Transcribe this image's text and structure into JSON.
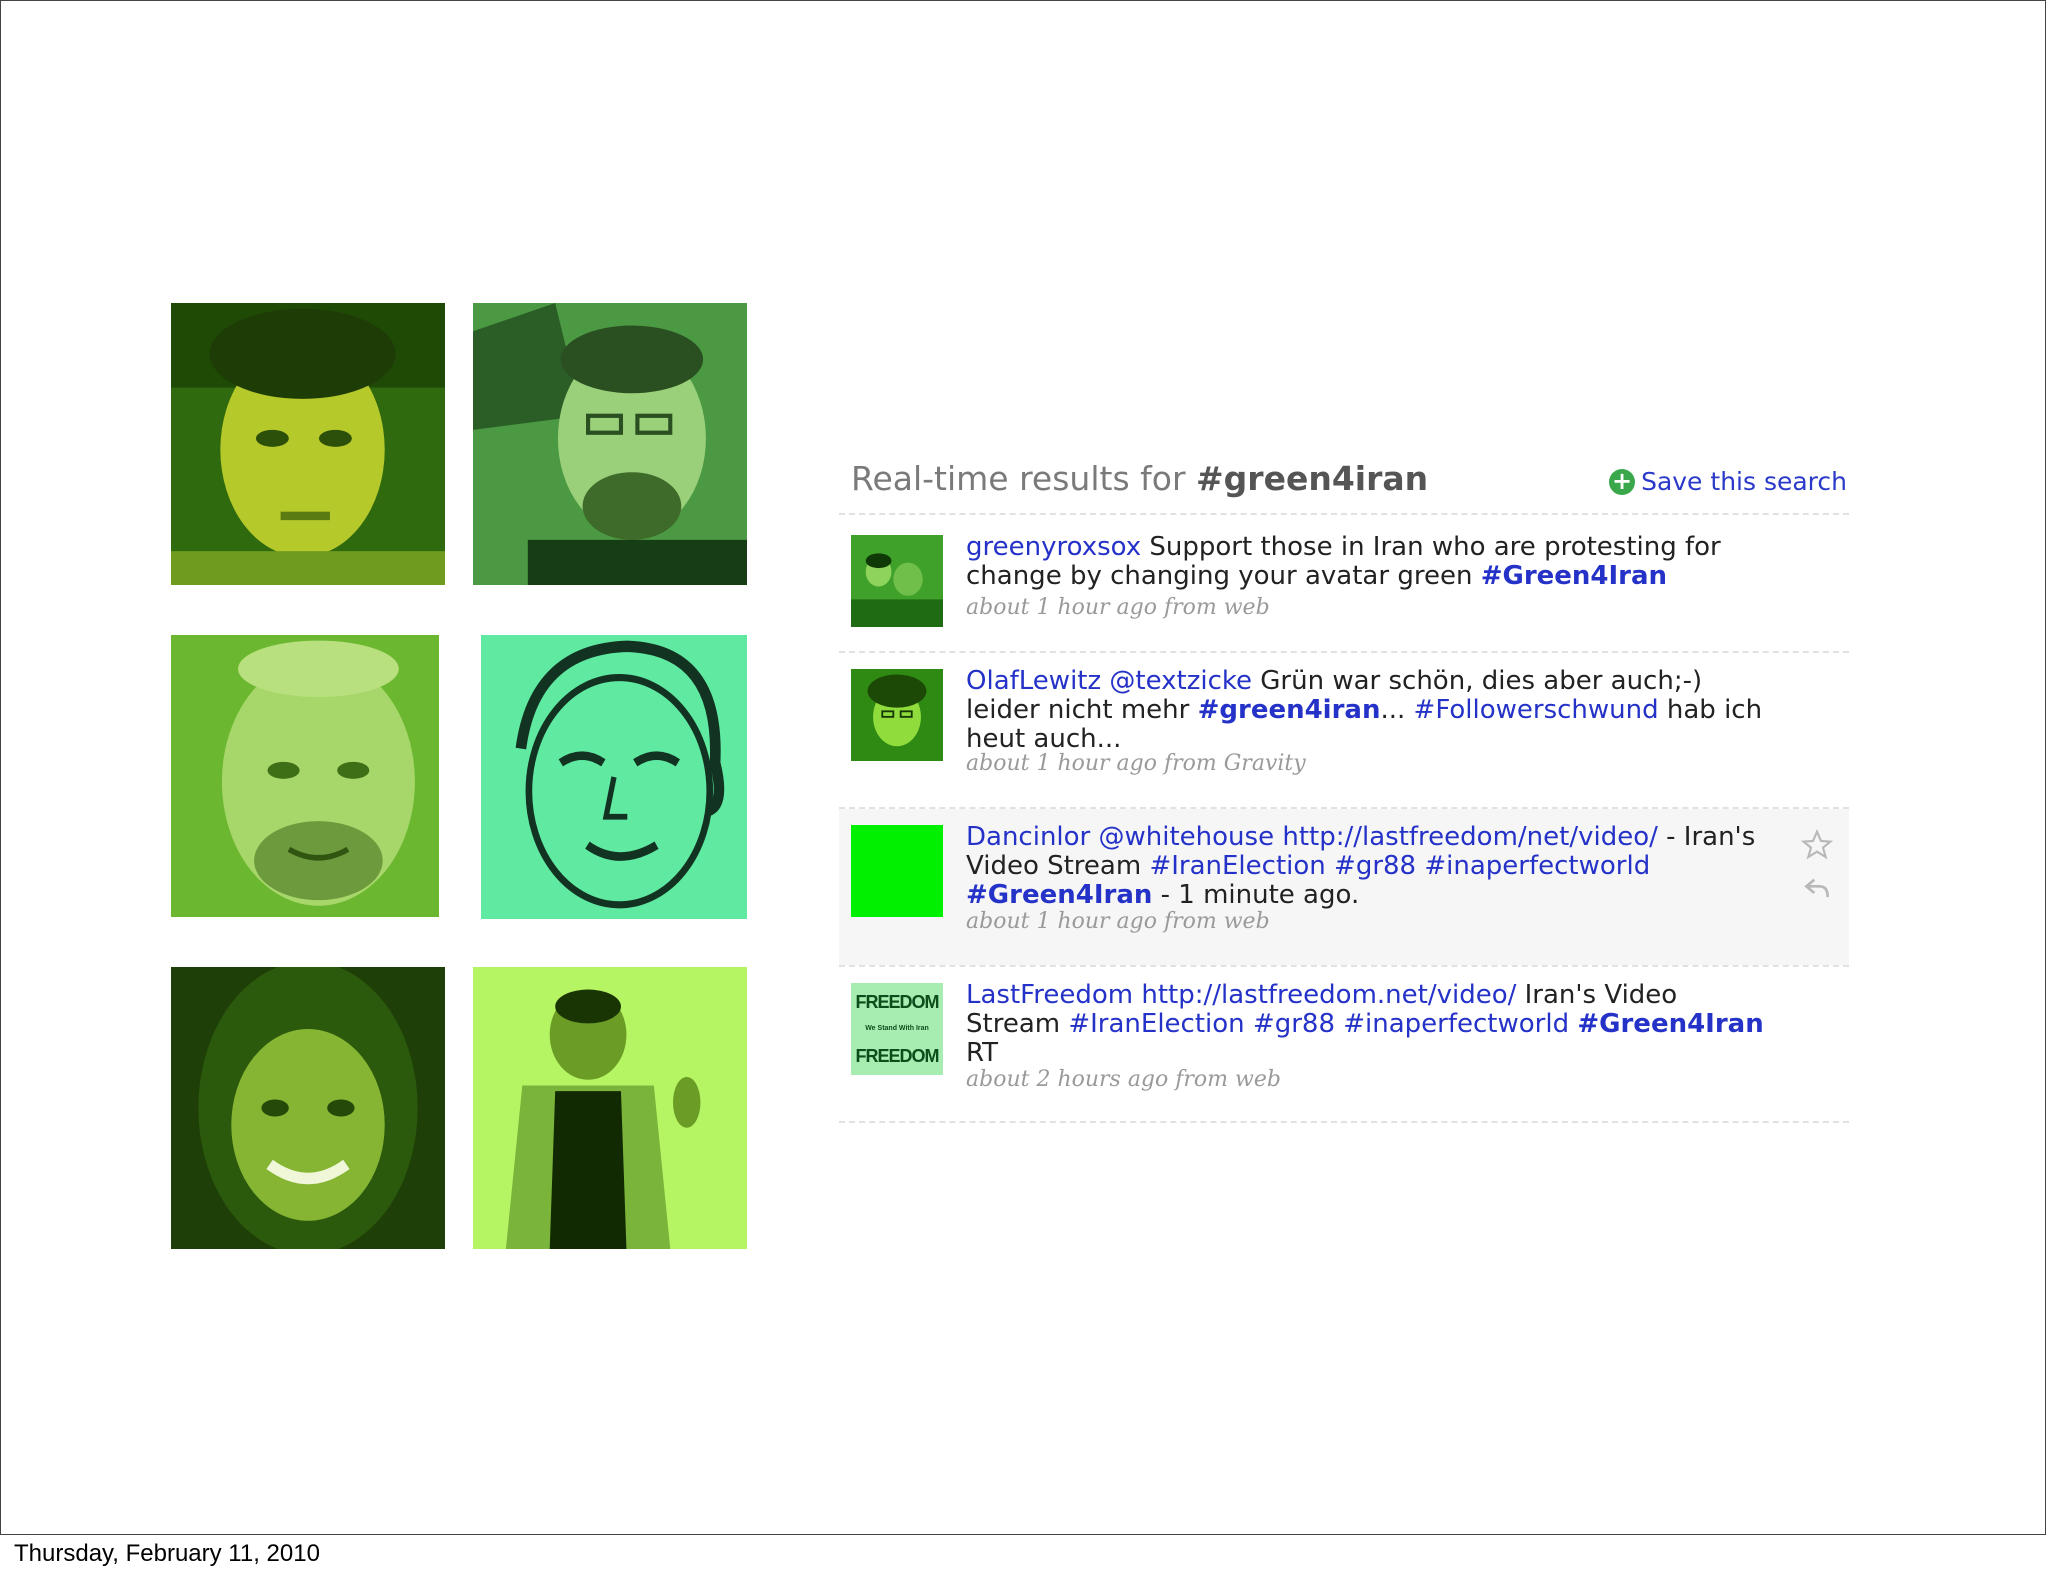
{
  "footer": {
    "date": "Thursday, February 11, 2010"
  },
  "avatars": [
    {
      "name": "face-1",
      "tint": "#5da81f"
    },
    {
      "name": "face-2",
      "tint": "#6fc26a"
    },
    {
      "name": "face-3",
      "tint": "#7cc43a"
    },
    {
      "name": "face-4",
      "tint": "#5fe9a1"
    },
    {
      "name": "face-5",
      "tint": "#3d7c12"
    },
    {
      "name": "face-6",
      "tint": "#a6f05c"
    }
  ],
  "search": {
    "title_prefix": "Real-time results for ",
    "query": "#green4iran",
    "save_label": "Save this search",
    "save_icon": "plus-circle-icon",
    "accent": "#3aa74a",
    "link_color": "#2532c8"
  },
  "tweets": [
    {
      "user": "greenyroxsox",
      "parts": [
        {
          "text": "Support those in Iran who are protesting for change by changing your avatar green ",
          "type": "text"
        },
        {
          "text": "#Green4Iran",
          "type": "tag-bold"
        }
      ],
      "meta": "about 1 hour ago from web"
    },
    {
      "user": "OlafLewitz",
      "parts": [
        {
          "text": "@textzicke",
          "type": "link"
        },
        {
          "text": " Grün war schön, dies aber auch;-) leider nicht mehr ",
          "type": "text"
        },
        {
          "text": "#green4iran",
          "type": "tag-bold"
        },
        {
          "text": "... ",
          "type": "text"
        },
        {
          "text": "#Followerschwund",
          "type": "link"
        },
        {
          "text": " hab ich heut auch...",
          "type": "text"
        }
      ],
      "meta": "about 1 hour ago from Gravity"
    },
    {
      "user": "Dancinlor",
      "parts": [
        {
          "text": "@whitehouse",
          "type": "link"
        },
        {
          "text": " ",
          "type": "text"
        },
        {
          "text": "http://lastfreedom/net/video/",
          "type": "link"
        },
        {
          "text": " - Iran's Video Stream ",
          "type": "text"
        },
        {
          "text": "#IranElection",
          "type": "link"
        },
        {
          "text": " ",
          "type": "text"
        },
        {
          "text": "#gr88",
          "type": "link"
        },
        {
          "text": " ",
          "type": "text"
        },
        {
          "text": "#inaperfectworld",
          "type": "link"
        },
        {
          "text": " ",
          "type": "text"
        },
        {
          "text": "#Green4Iran",
          "type": "tag-bold"
        },
        {
          "text": " - 1 minute ago.",
          "type": "text"
        }
      ],
      "meta": "about 1 hour ago from web"
    },
    {
      "user": "LastFreedom",
      "parts": [
        {
          "text": "http://lastfreedom.net/video/",
          "type": "link"
        },
        {
          "text": " Iran's Video Stream ",
          "type": "text"
        },
        {
          "text": "#IranElection",
          "type": "link"
        },
        {
          "text": " ",
          "type": "text"
        },
        {
          "text": "#gr88",
          "type": "link"
        },
        {
          "text": " ",
          "type": "text"
        },
        {
          "text": "#inaperfectworld",
          "type": "link"
        },
        {
          "text": " ",
          "type": "text"
        },
        {
          "text": "#Green4Iran",
          "type": "tag-bold"
        },
        {
          "text": " RT",
          "type": "text"
        }
      ],
      "meta": "about 2 hours ago from web",
      "avatar_text": [
        "FREEDOM",
        "We Stand With Iran",
        "FREEDOM"
      ]
    }
  ],
  "tweet_actions": {
    "favorite_icon": "star-icon",
    "reply_icon": "reply-icon"
  }
}
